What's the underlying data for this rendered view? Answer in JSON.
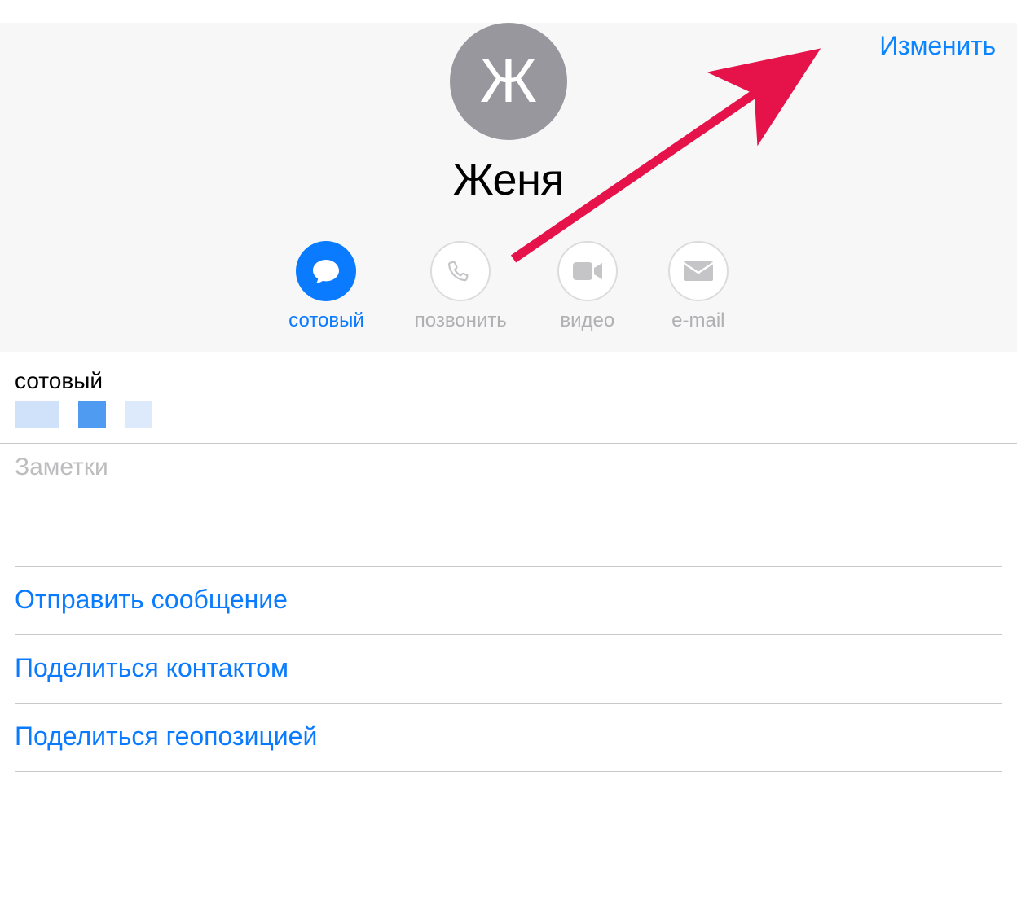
{
  "header": {
    "edit_label": "Изменить",
    "avatar_initial": "Ж",
    "contact_name": "Женя"
  },
  "actions": {
    "message": {
      "label": "сотовый",
      "active": true,
      "icon": "message-icon"
    },
    "call": {
      "label": "позвонить",
      "active": false,
      "icon": "phone-icon"
    },
    "video": {
      "label": "видео",
      "active": false,
      "icon": "video-icon"
    },
    "email": {
      "label": "e-mail",
      "active": false,
      "icon": "mail-icon"
    }
  },
  "phone": {
    "label": "сотовый"
  },
  "notes": {
    "placeholder": "Заметки"
  },
  "list": {
    "send_message": "Отправить сообщение",
    "share_contact": "Поделиться контактом",
    "share_location": "Поделиться геопозицией"
  }
}
